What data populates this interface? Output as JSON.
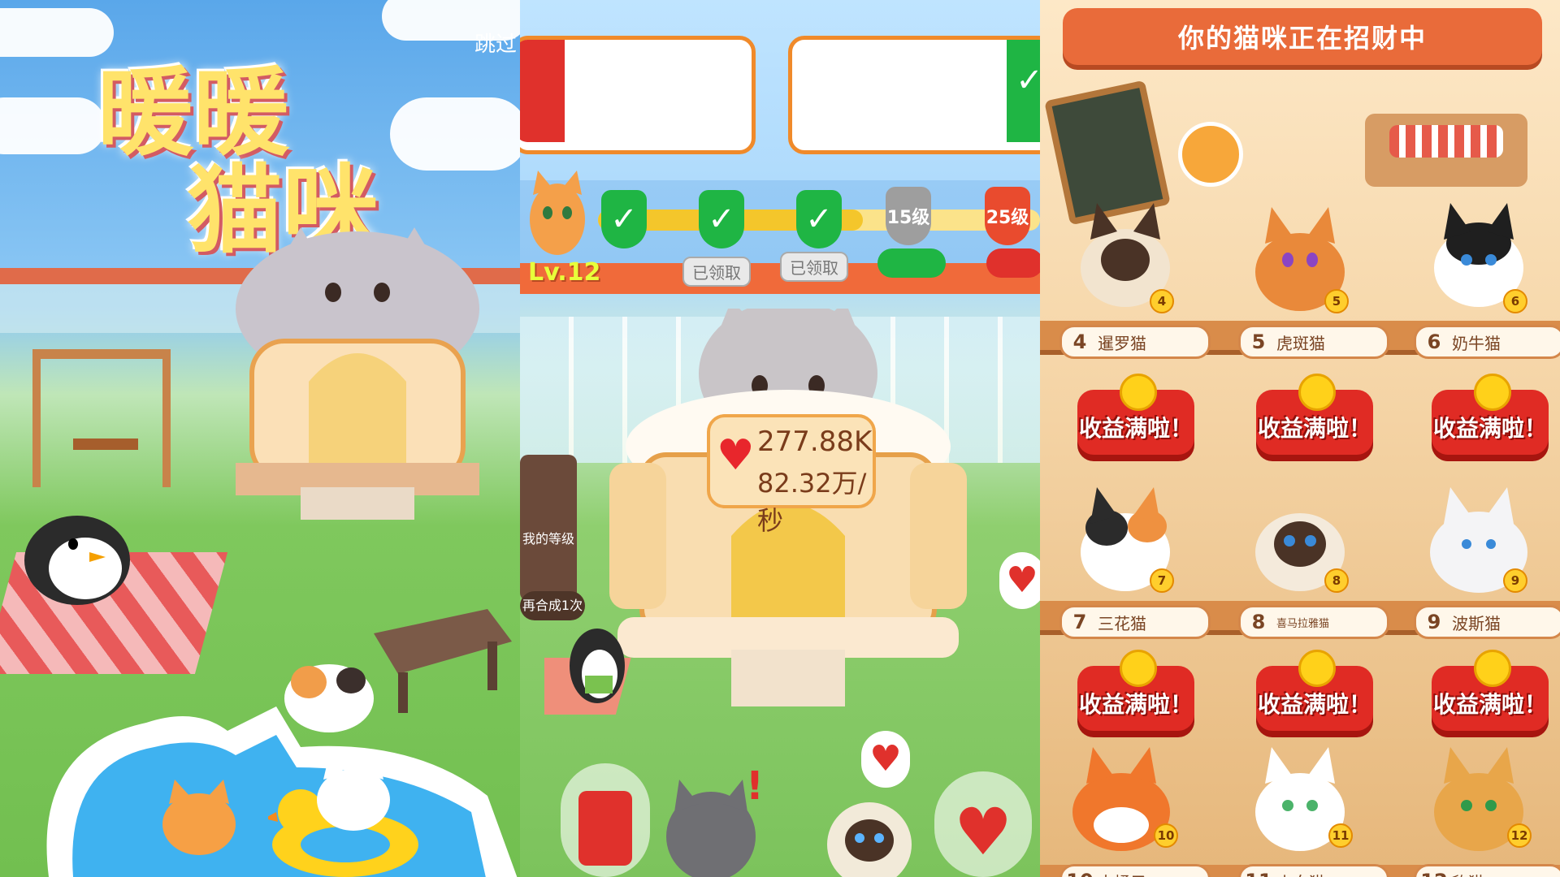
{
  "left": {
    "title_line1": "暖暖",
    "title_line2": "猫咪",
    "skip_label": "跳过"
  },
  "middle": {
    "player_level": "Lv.12",
    "milestones": [
      {
        "state": "done",
        "label": "已领取"
      },
      {
        "state": "done",
        "label": "已领取"
      },
      {
        "state": "done",
        "label": ""
      },
      {
        "level_label": "15级"
      },
      {
        "level_label": "25级"
      }
    ],
    "income_total": "277.88K",
    "income_rate": "82.32万/秒",
    "my_level_label": "我的等级",
    "merge_label": "再合成1次"
  },
  "right": {
    "banner": "你的猫咪正在招财中",
    "cats": [
      {
        "num": "4",
        "name": "暹罗猫",
        "level": "4"
      },
      {
        "num": "5",
        "name": "虎斑猫",
        "level": "5"
      },
      {
        "num": "6",
        "name": "奶牛猫",
        "level": "6"
      },
      {
        "num": "7",
        "name": "三花猫",
        "level": "7"
      },
      {
        "num": "8",
        "name": "喜马拉雅猫",
        "level": "8"
      },
      {
        "num": "9",
        "name": "波斯猫",
        "level": "9"
      },
      {
        "num": "10",
        "name": "大橘子",
        "level": "10"
      },
      {
        "num": "11",
        "name": "小白猫",
        "level": "11"
      },
      {
        "num": "12",
        "name": "豹猫",
        "level": "12"
      }
    ],
    "income_full_label": "收益满啦！"
  },
  "colors": {
    "orange": "#f08a2a",
    "red": "#e02b24",
    "green": "#1fb544",
    "gold": "#ffd11a"
  }
}
